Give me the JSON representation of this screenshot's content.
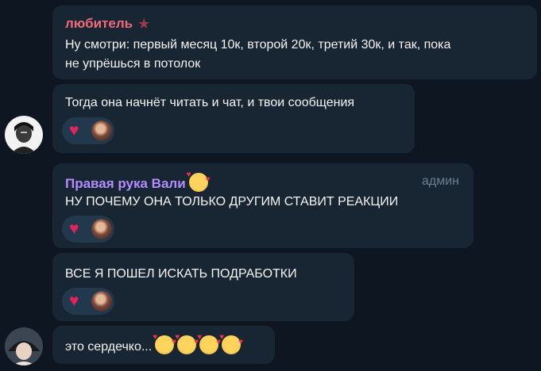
{
  "colors": {
    "background": "#0e1621",
    "bubble": "#182533",
    "sender_pink": "#f06a78",
    "sender_purple": "#b38dff",
    "role_gray": "#6d7f8f",
    "heart": "#e0245e"
  },
  "messages": [
    {
      "sender": "любитель",
      "badge_icon": "star-icon",
      "text_line1": "Ну смотри: первый месяц 10к, второй 20к, третий 30к, и так, пока",
      "text_line2": "не упрёшься в потолок"
    },
    {
      "text": "Тогда она начнёт читать и чат, и твои сообщения",
      "reaction": {
        "emoji": "heart-icon",
        "reactor": "user-avatar"
      }
    },
    {
      "sender": "Правая рука Вали",
      "sender_emoji": "smiling-face-with-hearts-icon",
      "role": "админ",
      "text": "НУ ПОЧЕМУ ОНА ТОЛЬКО ДРУГИМ СТАВИТ РЕАКЦИИ",
      "reaction": {
        "emoji": "heart-icon",
        "reactor": "user-avatar"
      }
    },
    {
      "text": "ВСЕ Я ПОШЕЛ ИСКАТЬ ПОДРАБОТКИ",
      "reaction": {
        "emoji": "heart-icon",
        "reactor": "user-avatar"
      }
    },
    {
      "text": "это сердечко...",
      "emojis": [
        "smiling-face-with-hearts-icon",
        "smiling-face-with-hearts-icon",
        "smiling-face-with-hearts-icon",
        "smiling-face-with-hearts-icon"
      ]
    }
  ],
  "reaction_heart": "♥"
}
